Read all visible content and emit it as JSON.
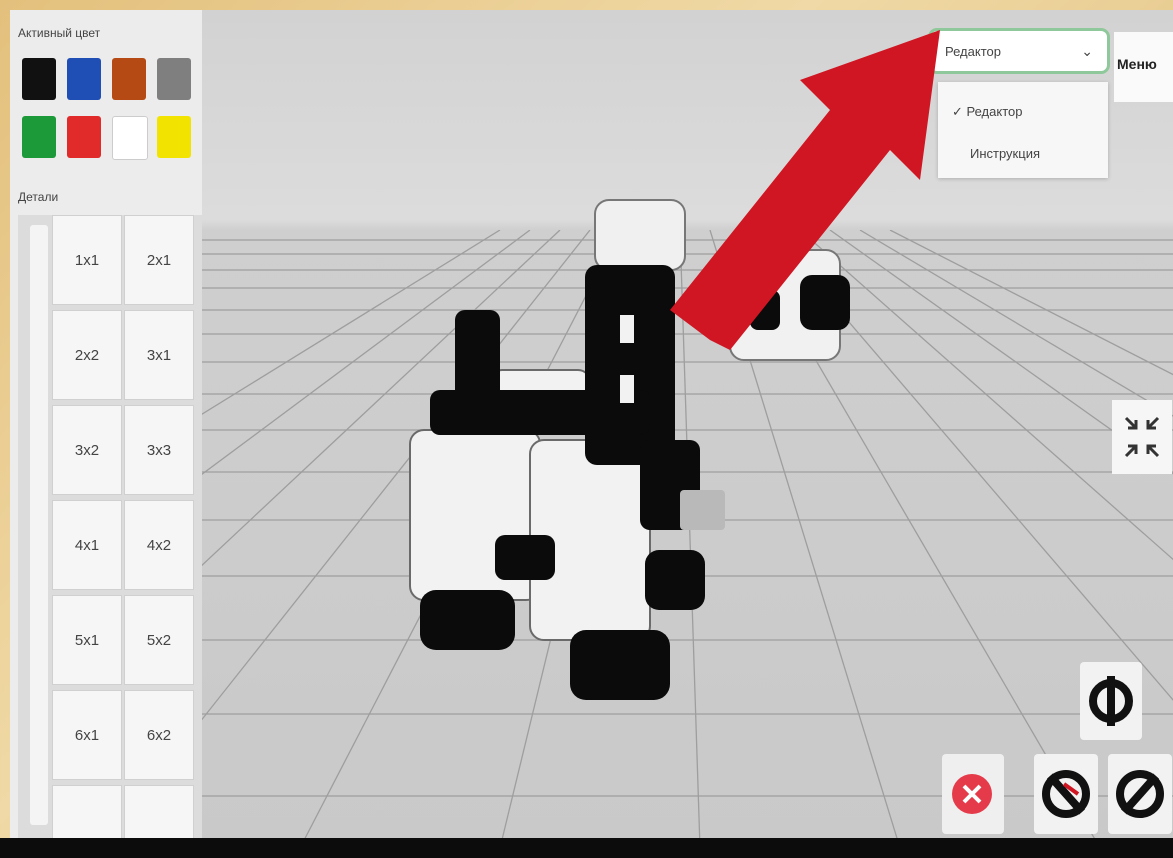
{
  "panel": {
    "active_color_label": "Активный цвет",
    "parts_label": "Детали",
    "colors": [
      "#111111",
      "#1f4fb5",
      "#b54a14",
      "#7f7f7f",
      "#1c9a3a",
      "#e12a2a",
      "#ffffff",
      "#f2e400"
    ],
    "parts": [
      [
        "1x1",
        "2x1"
      ],
      [
        "2x2",
        "3x1"
      ],
      [
        "3x2",
        "3x3"
      ],
      [
        "4x1",
        "4x2"
      ],
      [
        "5x1",
        "5x2"
      ],
      [
        "6x1",
        "6x2"
      ]
    ]
  },
  "mode_select": {
    "value": "Редактор",
    "options": [
      "Редактор",
      "Инструкция"
    ],
    "selected_index": 0
  },
  "menu_button": "Меню",
  "icons": {
    "arrow": "red-arrow-annotation",
    "fit": "fit-view-icon",
    "rotate": "rotate-icon",
    "delete": "delete-icon",
    "rotate_left": "rotate-left-icon",
    "rotate_right": "rotate-right-icon"
  },
  "colors": {
    "accent_green": "#8fc89a",
    "arrow_red": "#d01622",
    "delete_red": "#e53a4a"
  }
}
